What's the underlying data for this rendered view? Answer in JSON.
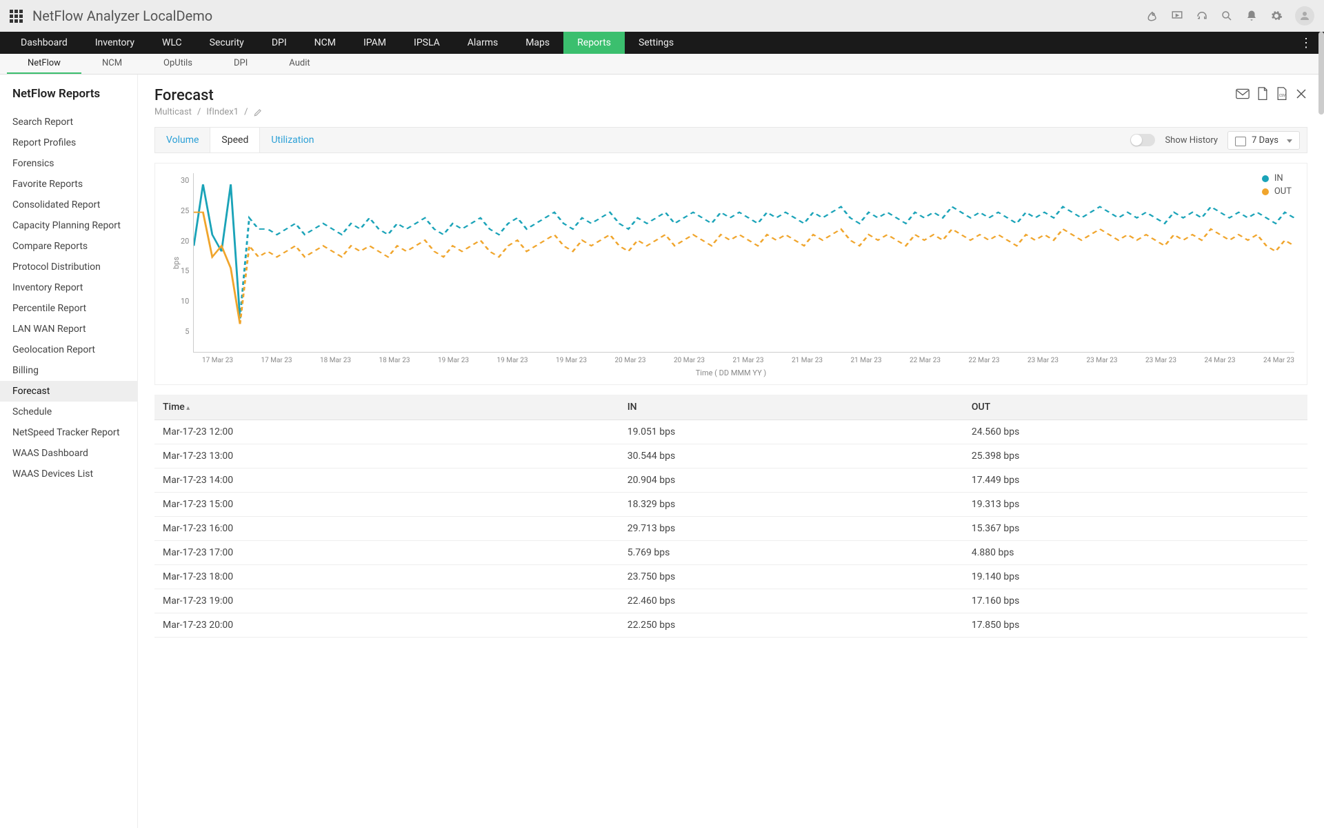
{
  "app_title": "NetFlow Analyzer LocalDemo",
  "mainnav": [
    "Dashboard",
    "Inventory",
    "WLC",
    "Security",
    "DPI",
    "NCM",
    "IPAM",
    "IPSLA",
    "Alarms",
    "Maps",
    "Reports",
    "Settings"
  ],
  "mainnav_active": "Reports",
  "subnav": [
    "NetFlow",
    "NCM",
    "OpUtils",
    "DPI",
    "Audit"
  ],
  "subnav_active": "NetFlow",
  "sidebar": {
    "title": "NetFlow Reports",
    "items": [
      "Search Report",
      "Report Profiles",
      "Forensics",
      "Favorite Reports",
      "Consolidated Report",
      "Capacity Planning Report",
      "Compare Reports",
      "Protocol Distribution",
      "Inventory Report",
      "Percentile Report",
      "LAN WAN Report",
      "Geolocation Report",
      "Billing",
      "Forecast",
      "Schedule",
      "NetSpeed Tracker Report",
      "WAAS Dashboard",
      "WAAS Devices List"
    ],
    "active": "Forecast"
  },
  "page": {
    "title": "Forecast",
    "crumbs": [
      "Multicast",
      "IfIndex1"
    ]
  },
  "tabs": [
    "Volume",
    "Speed",
    "Utilization"
  ],
  "tab_active": "Speed",
  "history_label": "Show History",
  "range": "7 Days",
  "legend": {
    "in": "IN",
    "out": "OUT",
    "in_color": "#1aa3b8",
    "out_color": "#f0a52c"
  },
  "ylabel": "bps",
  "xlabel": "Time ( DD MMM YY )",
  "yticks": [
    "30",
    "25",
    "20",
    "15",
    "10",
    "5"
  ],
  "xticks": [
    "17 Mar 23",
    "17 Mar 23",
    "18 Mar 23",
    "18 Mar 23",
    "19 Mar 23",
    "19 Mar 23",
    "19 Mar 23",
    "20 Mar 23",
    "20 Mar 23",
    "21 Mar 23",
    "21 Mar 23",
    "21 Mar 23",
    "22 Mar 23",
    "22 Mar 23",
    "23 Mar 23",
    "23 Mar 23",
    "23 Mar 23",
    "24 Mar 23",
    "24 Mar 23"
  ],
  "table": {
    "columns": [
      "Time",
      "IN",
      "OUT"
    ],
    "rows": [
      [
        "Mar-17-23 12:00",
        "19.051 bps",
        "24.560 bps"
      ],
      [
        "Mar-17-23 13:00",
        "30.544 bps",
        "25.398 bps"
      ],
      [
        "Mar-17-23 14:00",
        "20.904 bps",
        "17.449 bps"
      ],
      [
        "Mar-17-23 15:00",
        "18.329 bps",
        "19.313 bps"
      ],
      [
        "Mar-17-23 16:00",
        "29.713 bps",
        "15.367 bps"
      ],
      [
        "Mar-17-23 17:00",
        "5.769 bps",
        "4.880 bps"
      ],
      [
        "Mar-17-23 18:00",
        "23.750 bps",
        "19.140 bps"
      ],
      [
        "Mar-17-23 19:00",
        "22.460 bps",
        "17.160 bps"
      ],
      [
        "Mar-17-23 20:00",
        "22.250 bps",
        "17.850 bps"
      ]
    ]
  },
  "chart_data": {
    "type": "line",
    "ylabel": "bps",
    "xlabel": "Time ( DD MMM YY )",
    "ylim": [
      0,
      32
    ],
    "yticks": [
      5,
      10,
      15,
      20,
      25,
      30
    ],
    "x_dates": [
      "17 Mar 23",
      "18 Mar 23",
      "19 Mar 23",
      "20 Mar 23",
      "21 Mar 23",
      "22 Mar 23",
      "23 Mar 23",
      "24 Mar 23"
    ],
    "series": [
      {
        "name": "IN",
        "color": "#1aa3b8",
        "values_bps": [
          19,
          30,
          21,
          18,
          30,
          6,
          24,
          22,
          22,
          21,
          22,
          23,
          21,
          22,
          23,
          22,
          21,
          23,
          22,
          24,
          22,
          21,
          23,
          22,
          23,
          24,
          22,
          21,
          23,
          22,
          23,
          24,
          22,
          21,
          23,
          24,
          22,
          23,
          24,
          25,
          23,
          22,
          24,
          23,
          24,
          25,
          23,
          22,
          24,
          23,
          24,
          25,
          23,
          24,
          25,
          24,
          23,
          25,
          24,
          25,
          24,
          23,
          25,
          24,
          25,
          24,
          23,
          25,
          24,
          25,
          26,
          24,
          23,
          25,
          24,
          25,
          24,
          23,
          25,
          24,
          25,
          24,
          26,
          25,
          24,
          25,
          24,
          25,
          24,
          23,
          25,
          24,
          25,
          24,
          26,
          25,
          24,
          25,
          26,
          25,
          24,
          25,
          24,
          25,
          24,
          23,
          25,
          24,
          25,
          24,
          26,
          25,
          24,
          25,
          24,
          25,
          24,
          23,
          25,
          24
        ]
      },
      {
        "name": "OUT",
        "color": "#f0a52c",
        "values_bps": [
          25,
          25,
          17,
          19,
          15,
          5,
          19,
          17,
          18,
          17,
          18,
          19,
          17,
          18,
          19,
          18,
          17,
          19,
          18,
          19,
          18,
          17,
          19,
          18,
          19,
          20,
          18,
          17,
          19,
          18,
          19,
          20,
          18,
          17,
          19,
          20,
          18,
          19,
          20,
          21,
          19,
          18,
          20,
          19,
          20,
          21,
          19,
          18,
          20,
          19,
          20,
          21,
          19,
          20,
          21,
          20,
          19,
          21,
          20,
          21,
          20,
          19,
          21,
          20,
          21,
          20,
          19,
          21,
          20,
          21,
          22,
          20,
          19,
          21,
          20,
          21,
          20,
          19,
          21,
          20,
          21,
          20,
          22,
          21,
          20,
          21,
          20,
          21,
          20,
          19,
          21,
          20,
          21,
          20,
          22,
          21,
          20,
          21,
          22,
          21,
          20,
          21,
          20,
          21,
          20,
          19,
          21,
          20,
          21,
          20,
          22,
          21,
          20,
          21,
          20,
          21,
          19,
          18,
          20,
          19
        ]
      }
    ]
  }
}
